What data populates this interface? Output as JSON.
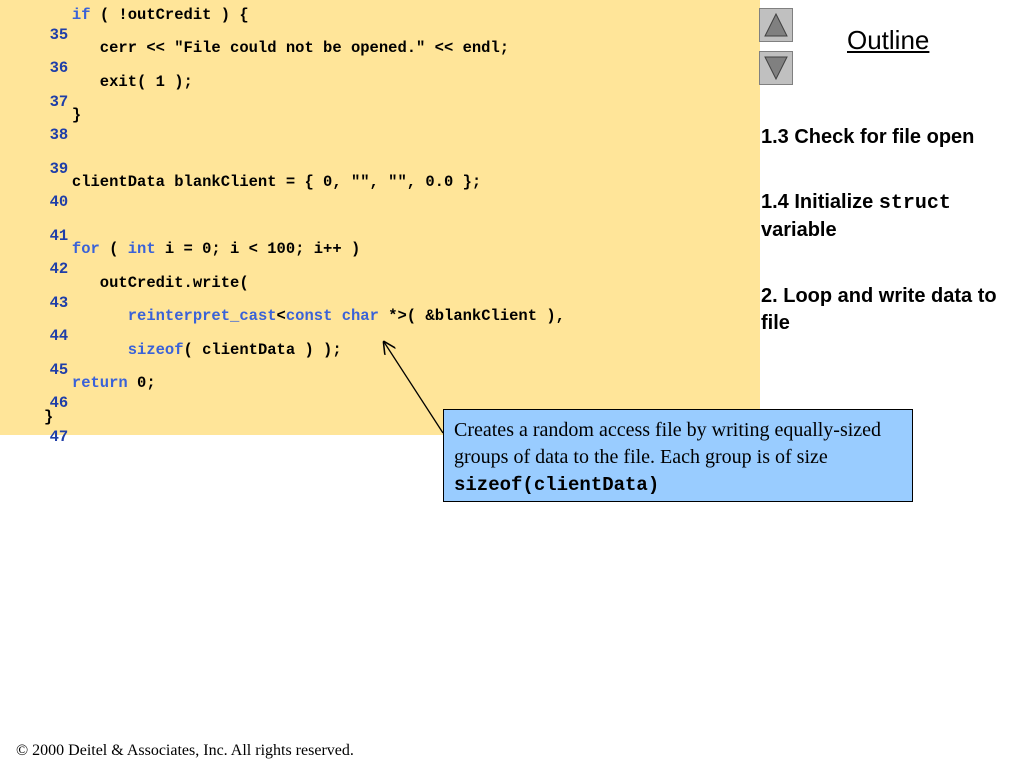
{
  "code": {
    "lines": [
      {
        "num": "35",
        "text": "   ",
        "kw1": "if",
        "rest": " ( !outCredit ) {"
      },
      {
        "num": "36",
        "text": "      cerr << \"File could not be opened.\" << endl;"
      },
      {
        "num": "37",
        "text": "      exit( 1 );"
      },
      {
        "num": "38",
        "text": "   }"
      },
      {
        "num": "39",
        "text": ""
      },
      {
        "num": "40",
        "text": "   clientData blankClient = { 0, \"\", \"\", 0.0 };"
      },
      {
        "num": "41",
        "text": ""
      },
      {
        "num": "42",
        "pre": "   ",
        "kw1": "for",
        "mid1": " ( ",
        "kw2": "int",
        "rest": " i = 0; i < 100; i++ )"
      },
      {
        "num": "43",
        "text": "      outCredit.write("
      },
      {
        "num": "44",
        "pre": "         ",
        "kw1": "reinterpret_cast",
        "mid1": "<",
        "kw2": "const",
        "mid2": " ",
        "kw3": "char",
        "rest": " *>( &blankClient ),"
      },
      {
        "num": "45",
        "pre": "         ",
        "kw1": "sizeof",
        "rest": "( clientData ) );"
      },
      {
        "num": "46",
        "pre": "   ",
        "kw1": "return",
        "rest": " 0;"
      },
      {
        "num": "47",
        "text": "}"
      }
    ]
  },
  "nav": {
    "up_icon": "triangle-up-icon",
    "down_icon": "triangle-down-icon",
    "outline_label": "Outline"
  },
  "outline_items": {
    "item1": "1.3 Check for file open",
    "item2_prefix": "1.4 Initialize ",
    "item2_code": "struct",
    "item2_suffix": "variable",
    "item3": "2. Loop and write data to file"
  },
  "callout": {
    "text": "Creates a random access file by writing equally-sized groups of data to the file.  Each group is of size ",
    "code": "sizeof(clientData)"
  },
  "footer": {
    "text": "© 2000 Deitel & Associates, Inc.  All rights reserved."
  },
  "colors": {
    "code_background": "#ffe599",
    "keyword": "#3a62d8",
    "line_number": "#1f3ea8",
    "callout_background": "#99ccff",
    "nav_button": "#c0c0c0"
  }
}
